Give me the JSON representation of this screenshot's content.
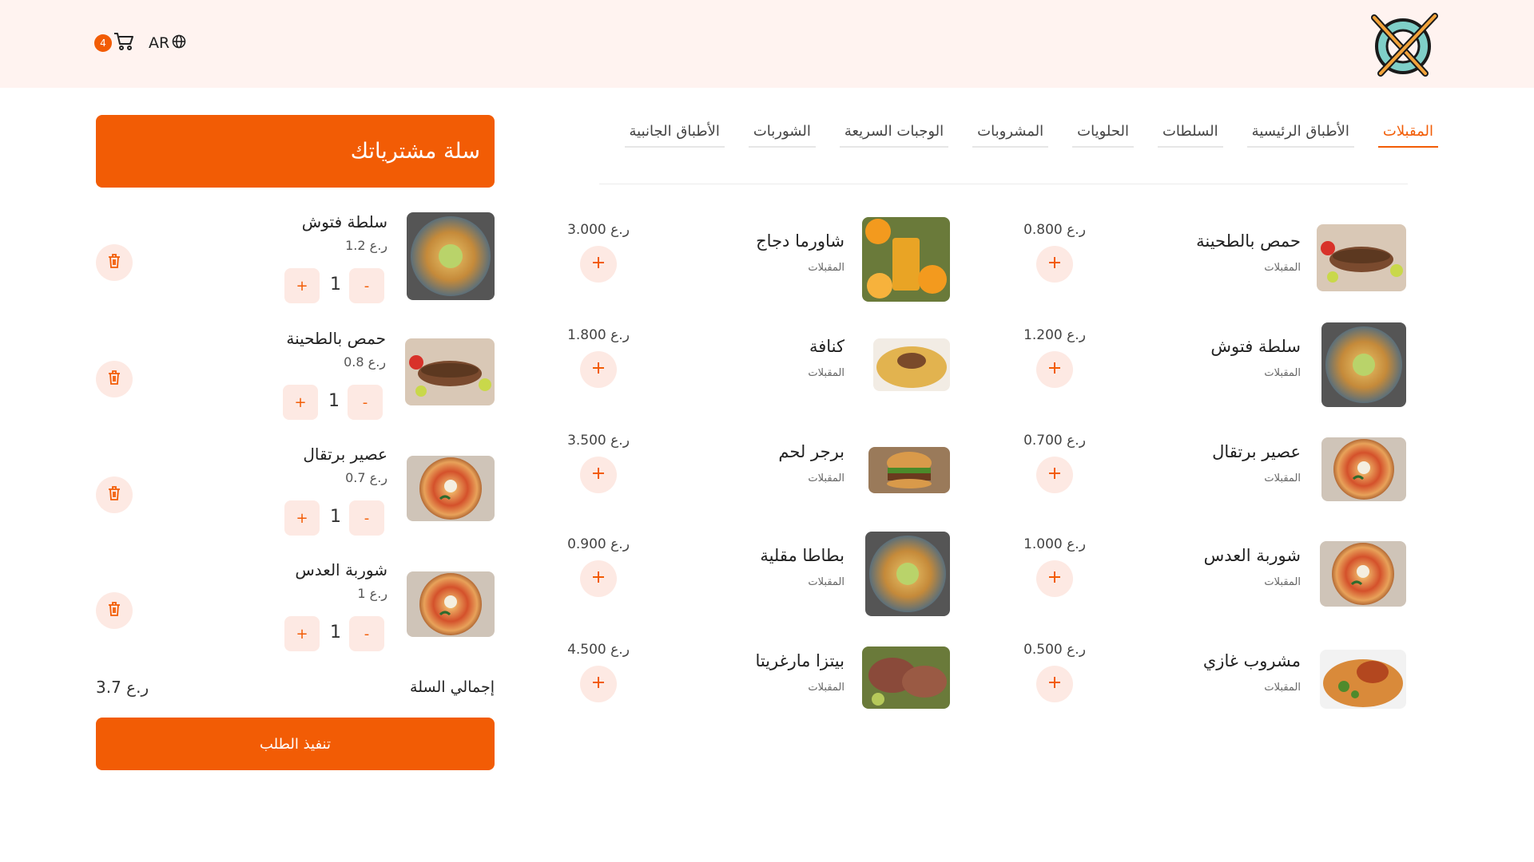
{
  "header": {
    "cart_count": "4",
    "lang_label": "AR",
    "logo_icon": "fork-knife-plate-logo",
    "cart_icon": "cart-icon",
    "globe_icon": "globe-icon"
  },
  "colors": {
    "accent": "#f25c05",
    "accent_soft": "#fde9e3",
    "header_bg": "#fff3f0"
  },
  "tabs": [
    {
      "label": "المقبلات",
      "active": true
    },
    {
      "label": "الأطباق الرئيسية",
      "active": false
    },
    {
      "label": "السلطات",
      "active": false
    },
    {
      "label": "الحلويات",
      "active": false
    },
    {
      "label": "المشروبات",
      "active": false
    },
    {
      "label": "الوجبات السريعة",
      "active": false
    },
    {
      "label": "الشوربات",
      "active": false
    },
    {
      "label": "الأطباق الجانبية",
      "active": false
    }
  ],
  "products": [
    {
      "name": "حمص بالطحينة",
      "category": "المقبلات",
      "price": "0.800 ر.ع",
      "image": "grilled-kebab"
    },
    {
      "name": "سلطة فتوش",
      "category": "المقبلات",
      "price": "1.200 ر.ع",
      "image": "platter"
    },
    {
      "name": "عصير برتقال",
      "category": "المقبلات",
      "price": "0.700 ر.ع",
      "image": "pizza"
    },
    {
      "name": "شوربة العدس",
      "category": "المقبلات",
      "price": "1.000 ر.ع",
      "image": "pizza"
    },
    {
      "name": "مشروب غازي",
      "category": "المقبلات",
      "price": "0.500 ر.ع",
      "image": "rice-chicken"
    },
    {
      "name": "شاورما دجاج",
      "category": "المقبلات",
      "price": "3.000 ر.ع",
      "image": "orange-juice"
    },
    {
      "name": "كنافة",
      "category": "المقبلات",
      "price": "1.800 ر.ع",
      "image": "rice-meat"
    },
    {
      "name": "برجر لحم",
      "category": "المقبلات",
      "price": "3.500 ر.ع",
      "image": "burger"
    },
    {
      "name": "بطاطا مقلية",
      "category": "المقبلات",
      "price": "0.900 ر.ع",
      "image": "platter"
    },
    {
      "name": "بيتزا مارغريتا",
      "category": "المقبلات",
      "price": "4.500 ر.ع",
      "image": "steak"
    }
  ],
  "cart": {
    "title": "سلة مشترياتك",
    "items": [
      {
        "name": "سلطة فتوش",
        "price": "1.2 ر.ع",
        "qty": "1",
        "image": "platter"
      },
      {
        "name": "حمص بالطحينة",
        "price": "0.8 ر.ع",
        "qty": "1",
        "image": "grilled-kebab"
      },
      {
        "name": "عصير برتقال",
        "price": "0.7 ر.ع",
        "qty": "1",
        "image": "pizza"
      },
      {
        "name": "شوربة العدس",
        "price": "1 ر.ع",
        "qty": "1",
        "image": "pizza"
      }
    ],
    "plus_label": "+",
    "minus_label": "-",
    "total_label": "إجمالي السلة",
    "total_value": "3.7 ر.ع",
    "checkout_label": "تنفيذ الطلب"
  }
}
